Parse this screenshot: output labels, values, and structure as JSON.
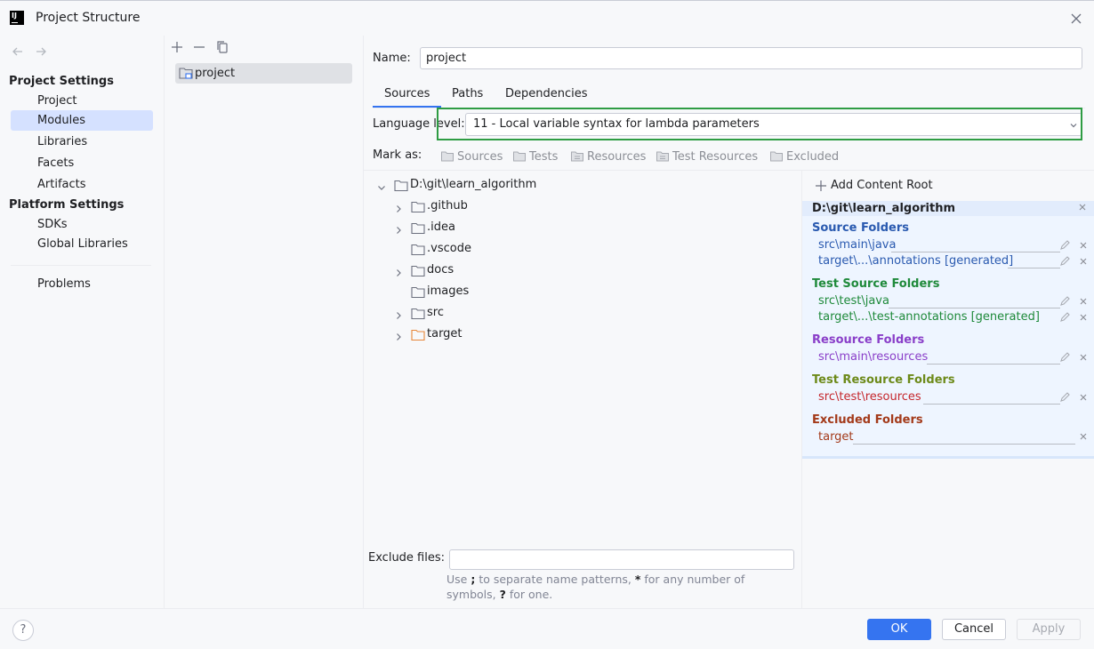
{
  "window": {
    "title": "Project Structure",
    "logo_text": "IJ"
  },
  "nav": {
    "project_settings_header": "Project Settings",
    "project_settings_items": [
      "Project",
      "Modules",
      "Libraries",
      "Facets",
      "Artifacts"
    ],
    "platform_settings_header": "Platform Settings",
    "platform_settings_items": [
      "SDKs",
      "Global Libraries"
    ],
    "problems": "Problems",
    "selected": "Modules"
  },
  "modules": {
    "items": [
      "project"
    ]
  },
  "module": {
    "name_label": "Name:",
    "name_value": "project",
    "tabs": [
      "Sources",
      "Paths",
      "Dependencies"
    ],
    "active_tab": "Sources",
    "language_level_label": "Language level:",
    "language_level_value": "11 - Local variable syntax for lambda parameters",
    "mark_as_label": "Mark as:",
    "mark_as": [
      "Sources",
      "Tests",
      "Resources",
      "Test Resources",
      "Excluded"
    ]
  },
  "tree": {
    "root": "D:\\git\\learn_algorithm",
    "children": [
      ".github",
      ".idea",
      ".vscode",
      "docs",
      "images",
      "src",
      "target"
    ]
  },
  "exclude": {
    "label": "Exclude files:",
    "value": "",
    "help_1": "Use",
    "help_sym1": ";",
    "help_2": "to separate name patterns,",
    "help_sym2": "*",
    "help_3": "for any number of symbols,",
    "help_sym3": "?",
    "help_4": "for one."
  },
  "content_root": {
    "add_label": "Add Content Root",
    "path": "D:\\git\\learn_algorithm",
    "source_folders_title": "Source Folders",
    "source_folders": [
      "src\\main\\java",
      "target\\...\\annotations [generated]"
    ],
    "test_source_folders_title": "Test Source Folders",
    "test_source_folders": [
      "src\\test\\java",
      "target\\...\\test-annotations [generated]"
    ],
    "resource_folders_title": "Resource Folders",
    "resource_folders": [
      "src\\main\\resources"
    ],
    "test_resource_folders_title": "Test Resource Folders",
    "test_resource_folders": [
      "src\\test\\resources"
    ],
    "excluded_folders_title": "Excluded Folders",
    "excluded_folders": [
      "target"
    ]
  },
  "buttons": {
    "ok": "OK",
    "cancel": "Cancel",
    "apply": "Apply",
    "help": "?"
  },
  "colors": {
    "accent": "#3574f0",
    "selection": "#d5e1ff",
    "highlight_box": "#2e9c43"
  }
}
